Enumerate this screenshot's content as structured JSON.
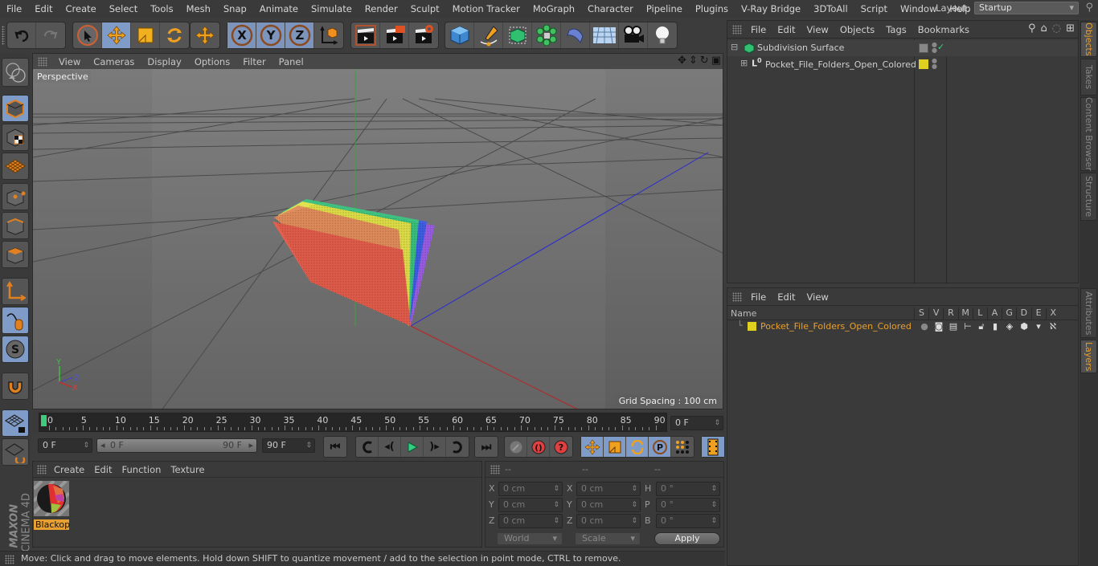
{
  "menubar": {
    "items": [
      "File",
      "Edit",
      "Create",
      "Select",
      "Tools",
      "Mesh",
      "Snap",
      "Animate",
      "Simulate",
      "Render",
      "Sculpt",
      "Motion Tracker",
      "MoGraph",
      "Character",
      "Pipeline",
      "Plugins",
      "V-Ray Bridge",
      "3DToAll",
      "Script",
      "Window",
      "Help"
    ],
    "layout_label": "Layout:",
    "layout_value": "Startup"
  },
  "viewport": {
    "menu": [
      "View",
      "Cameras",
      "Display",
      "Options",
      "Filter",
      "Panel"
    ],
    "camera_label": "Perspective",
    "grid_spacing": "Grid Spacing : 100 cm",
    "axis_labels": {
      "x": "X",
      "y": "Y",
      "z": "Z"
    }
  },
  "timeline": {
    "ticks": [
      "0",
      "5",
      "10",
      "15",
      "20",
      "25",
      "30",
      "35",
      "40",
      "45",
      "50",
      "55",
      "60",
      "65",
      "70",
      "75",
      "80",
      "85",
      "90"
    ],
    "current_frame": "0 F",
    "start_field": "0 F",
    "range_start": "0 F",
    "range_end": "90 F",
    "end_field": "90 F",
    "playhead_fraction": 0.0
  },
  "material_panel": {
    "menu": [
      "Create",
      "Edit",
      "Function",
      "Texture"
    ],
    "materials": [
      {
        "name": "Blackop"
      }
    ]
  },
  "coord_panel": {
    "headers": [
      "--",
      "--",
      "--"
    ],
    "rows": [
      {
        "l1": "X",
        "v1": "0 cm",
        "l2": "X",
        "v2": "0 cm",
        "l3": "H",
        "v3": "0 °"
      },
      {
        "l1": "Y",
        "v1": "0 cm",
        "l2": "Y",
        "v2": "0 cm",
        "l3": "P",
        "v3": "0 °"
      },
      {
        "l1": "Z",
        "v1": "0 cm",
        "l2": "Z",
        "v2": "0 cm",
        "l3": "B",
        "v3": "0 °"
      }
    ],
    "mode_select": "World",
    "type_select": "Scale",
    "apply_label": "Apply"
  },
  "object_manager": {
    "menu": [
      "File",
      "Edit",
      "View",
      "Objects",
      "Tags",
      "Bookmarks"
    ],
    "objects": [
      {
        "name": "Subdivision Surface",
        "indent": 0,
        "expander": "minus"
      },
      {
        "name": "Pocket_File_Folders_Open_Colored",
        "indent": 1,
        "expander": "plus"
      }
    ],
    "layer_color": "#e0d020"
  },
  "layer_manager": {
    "menu": [
      "File",
      "Edit",
      "View"
    ],
    "columns": [
      "Name",
      "S",
      "V",
      "R",
      "M",
      "L",
      "A",
      "G",
      "D",
      "E",
      "X"
    ],
    "layers": [
      {
        "name": "Pocket_File_Folders_Open_Colored",
        "color": "#e0d020"
      }
    ]
  },
  "right_tabs": {
    "top": [
      "Objects",
      "Takes",
      "Content Browser",
      "Structure"
    ],
    "bottom": [
      "Attributes",
      "Layers"
    ]
  },
  "brand": {
    "line1": "MAXON",
    "line2": "CINEMA 4D"
  },
  "status_bar": "Move: Click and drag to move elements. Hold down SHIFT to quantize movement / add to the selection in point mode, CTRL to remove.",
  "colors": {
    "accent": "#e8a030",
    "selected": "#7f9bc7",
    "playhead": "#3ecb7c"
  }
}
